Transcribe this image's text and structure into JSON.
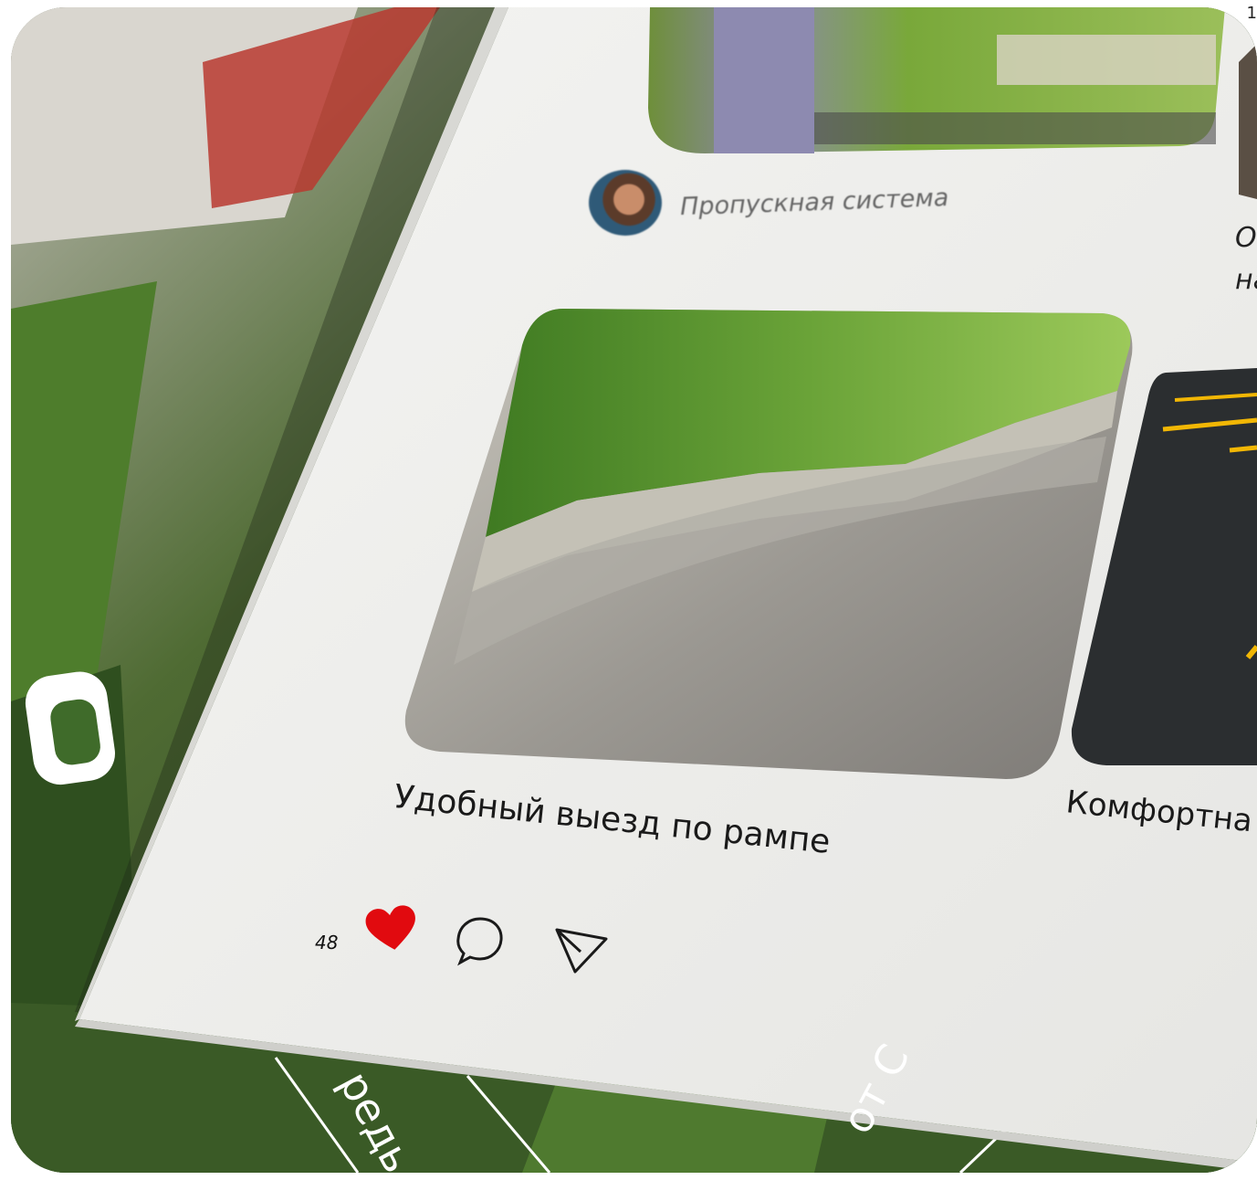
{
  "page_number": "1",
  "avatar_label": "Пропускная система",
  "captions": {
    "ramp": "Удобный выезд по рампе",
    "parking": "Комфортна",
    "right_top_line1": "О",
    "right_top_line2": "на"
  },
  "likes": {
    "count": "48",
    "liked": true,
    "heart_color": "#e10a0f"
  },
  "icons": [
    "heart-icon",
    "comment-icon",
    "send-icon"
  ],
  "background_words": {
    "word1": "редь",
    "word2": "от С"
  },
  "colors": {
    "page_paper": "#eeeeec",
    "brand_green": "#3f6b2a",
    "asphalt": "#2b2e30",
    "road_line": "#f2b705"
  }
}
